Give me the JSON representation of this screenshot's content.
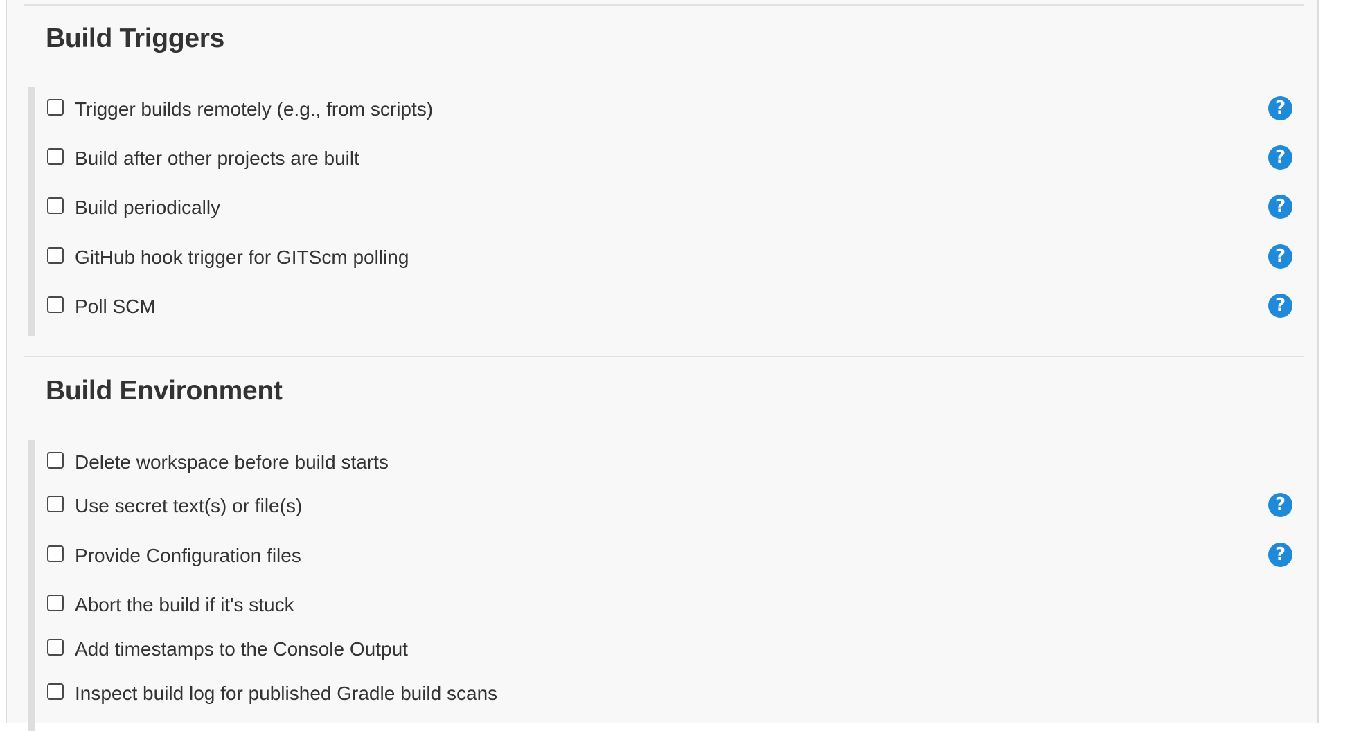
{
  "build_triggers": {
    "title": "Build Triggers",
    "items": [
      {
        "label": "Trigger builds remotely (e.g., from scripts)",
        "checked": false,
        "has_help": true
      },
      {
        "label": "Build after other projects are built",
        "checked": false,
        "has_help": true
      },
      {
        "label": "Build periodically",
        "checked": false,
        "has_help": true
      },
      {
        "label": "GitHub hook trigger for GITScm polling",
        "checked": false,
        "has_help": true
      },
      {
        "label": "Poll SCM",
        "checked": false,
        "has_help": true
      }
    ]
  },
  "build_environment": {
    "title": "Build Environment",
    "items": [
      {
        "label": "Delete workspace before build starts",
        "checked": false,
        "has_help": false
      },
      {
        "label": "Use secret text(s) or file(s)",
        "checked": false,
        "has_help": true
      },
      {
        "label": "Provide Configuration files",
        "checked": false,
        "has_help": true
      },
      {
        "label": "Abort the build if it's stuck",
        "checked": false,
        "has_help": false
      },
      {
        "label": "Add timestamps to the Console Output",
        "checked": false,
        "has_help": false
      },
      {
        "label": "Inspect build log for published Gradle build scans",
        "checked": false,
        "has_help": false
      }
    ]
  },
  "help_icon": {
    "glyph": "?",
    "icon": "help-icon",
    "color": "#1f8ad9"
  }
}
